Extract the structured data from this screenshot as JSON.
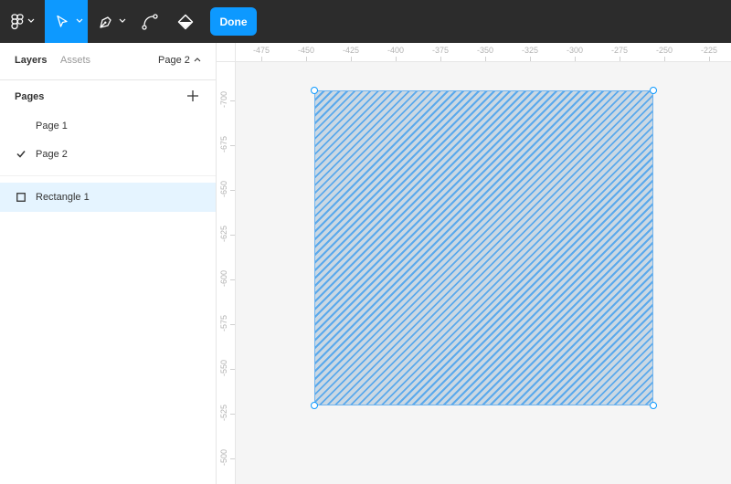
{
  "toolbar": {
    "done_label": "Done",
    "icons": [
      "figma-menu-icon",
      "move-tool-icon",
      "pen-tool-icon",
      "bend-tool-icon",
      "paint-bucket-icon"
    ]
  },
  "panel": {
    "tabs": {
      "layers": "Layers",
      "assets": "Assets"
    },
    "current_page": "Page 2",
    "pages_heading": "Pages",
    "pages": [
      "Page 1",
      "Page 2"
    ],
    "selected_page": "Page 2",
    "layers": [
      {
        "name": "Rectangle 1",
        "type": "rectangle"
      }
    ]
  },
  "rulers": {
    "x_ticks": [
      "-475",
      "-450",
      "-425",
      "-400",
      "-375",
      "-350",
      "-325",
      "-300",
      "-275",
      "-250",
      "-225"
    ],
    "y_ticks": [
      "-700",
      "-675",
      "-650",
      "-625",
      "-600",
      "-575",
      "-550",
      "-525",
      "-500"
    ]
  },
  "colors": {
    "accent": "#0d99ff",
    "toolbar_bg": "#2c2c2c",
    "selection_row": "#e5f4ff",
    "canvas_bg": "#f5f5f5"
  }
}
